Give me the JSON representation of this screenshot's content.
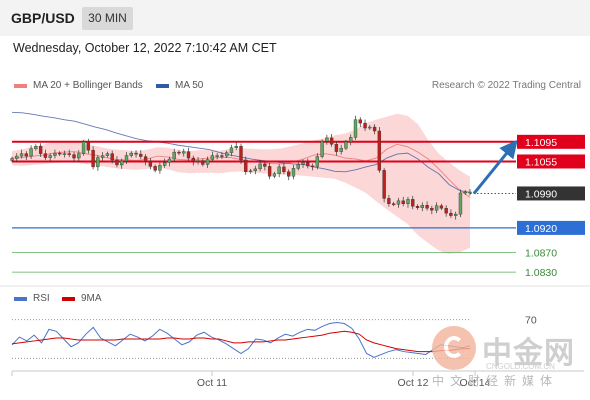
{
  "header": {
    "symbol": "GBP/USD",
    "timeframe": "30 MIN"
  },
  "datetime": "Wednesday, October 12, 2022 7:10:42 AM CET",
  "legend": {
    "bb_label": "MA 20 + Bollinger Bands",
    "bb_color": "#f08080",
    "ma50_label": "MA 50",
    "ma50_color": "#2e5da8"
  },
  "copyright": "Research © 2022 Trading Central",
  "rsi_legend": {
    "rsi_label": "RSI",
    "rsi_color": "#4a74c9",
    "ma_label": "9MA",
    "ma_color": "#d00000"
  },
  "watermark": {
    "brand": "中金网",
    "url": "CNGOLD.COM.CN",
    "subtitle": "中文财经新媒体"
  },
  "colors": {
    "resistance": "#e0001b",
    "support": "#2e6fd6",
    "target": "#5aab5a",
    "current": "#333333",
    "bull": "#5fa85f",
    "bear": "#c0201b",
    "arrow": "#2e6fb4"
  },
  "chart_data": [
    {
      "type": "candlestick",
      "y_axis_side": "right",
      "ylim": [
        1.081,
        1.118
      ],
      "x_ticks": [
        "Oct 11",
        "Oct 12",
        "Oct 14"
      ],
      "levels": [
        {
          "value": 1.1095,
          "label": "1.1095",
          "kind": "resistance"
        },
        {
          "value": 1.1055,
          "label": "1.1055",
          "kind": "resistance"
        },
        {
          "value": 1.099,
          "label": "1.0990",
          "kind": "current"
        },
        {
          "value": 1.092,
          "label": "1.0920",
          "kind": "support"
        },
        {
          "value": 1.087,
          "label": "1.0870",
          "kind": "target"
        },
        {
          "value": 1.083,
          "label": "1.0830",
          "kind": "target"
        }
      ],
      "closes": [
        1.1061,
        1.1066,
        1.1071,
        1.1066,
        1.1081,
        1.1086,
        1.1071,
        1.1063,
        1.1067,
        1.1072,
        1.107,
        1.1071,
        1.1069,
        1.1062,
        1.1071,
        1.1095,
        1.1078,
        1.1044,
        1.1063,
        1.1067,
        1.1071,
        1.1058,
        1.1048,
        1.1056,
        1.1067,
        1.1072,
        1.107,
        1.1065,
        1.1055,
        1.1045,
        1.1037,
        1.1047,
        1.1053,
        1.106,
        1.1074,
        1.1072,
        1.1075,
        1.1062,
        1.1055,
        1.1057,
        1.1049,
        1.1059,
        1.1067,
        1.1067,
        1.1066,
        1.1073,
        1.1083,
        1.1086,
        1.1058,
        1.1034,
        1.1036,
        1.104,
        1.105,
        1.1045,
        1.1025,
        1.103,
        1.1044,
        1.1034,
        1.1025,
        1.1041,
        1.1049,
        1.1053,
        1.1046,
        1.1045,
        1.1065,
        1.1096,
        1.1103,
        1.109,
        1.1075,
        1.1082,
        1.1095,
        1.1104,
        1.114,
        1.1133,
        1.1123,
        1.1125,
        1.1117,
        1.1037,
        1.098,
        1.0969,
        1.0968,
        1.0975,
        1.0969,
        1.0978,
        1.0964,
        1.0961,
        1.0966,
        1.096,
        1.0956,
        1.0965,
        1.096,
        1.095,
        1.0945,
        1.0948,
        1.0991,
        1.0993,
        1.0993
      ],
      "ma50": [
        1.1155,
        1.1154,
        1.1151,
        1.1147,
        1.1144,
        1.114,
        1.1137,
        1.1131,
        1.1125,
        1.112,
        1.1113,
        1.1107,
        1.1101,
        1.1097,
        1.1095,
        1.1092,
        1.1088,
        1.1085,
        1.1082,
        1.1079,
        1.1073,
        1.1068,
        1.1064,
        1.106,
        1.1057,
        1.1055,
        1.1052,
        1.105,
        1.1049,
        1.1044,
        1.104,
        1.1035,
        1.1034,
        1.1038,
        1.1044,
        1.1049,
        1.1062,
        1.107,
        1.1072,
        1.106,
        1.1043,
        1.103,
        1.1008,
        1.0996,
        1.0992
      ],
      "bb_mid": [
        1.1062,
        1.1063,
        1.1066,
        1.1068,
        1.1072,
        1.1074,
        1.1075,
        1.1071,
        1.1068,
        1.1063,
        1.1059,
        1.1058,
        1.1057,
        1.106,
        1.1066,
        1.1064,
        1.1059,
        1.1058,
        1.106,
        1.1062,
        1.1063,
        1.1063,
        1.1059,
        1.1055,
        1.1053,
        1.1051,
        1.105,
        1.1054,
        1.106,
        1.1068,
        1.1071,
        1.1068,
        1.1062,
        1.106,
        1.1056,
        1.1062,
        1.108,
        1.109,
        1.1085,
        1.1074,
        1.106,
        1.104,
        1.1018,
        1.0997,
        1.0982
      ],
      "bb_upper": [
        1.1076,
        1.108,
        1.1085,
        1.1089,
        1.1095,
        1.1096,
        1.1096,
        1.109,
        1.1087,
        1.1082,
        1.1079,
        1.1078,
        1.1076,
        1.1079,
        1.1084,
        1.1083,
        1.1078,
        1.1076,
        1.1078,
        1.1078,
        1.1077,
        1.1081,
        1.1082,
        1.1081,
        1.108,
        1.108,
        1.1082,
        1.1087,
        1.1092,
        1.1098,
        1.1102,
        1.1108,
        1.1112,
        1.112,
        1.1133,
        1.114,
        1.1146,
        1.1152,
        1.1148,
        1.1131,
        1.1098,
        1.1071,
        1.1053,
        1.1037,
        1.1024
      ],
      "bb_lower": [
        1.1047,
        1.1046,
        1.1048,
        1.105,
        1.1052,
        1.1053,
        1.1054,
        1.105,
        1.1048,
        1.1044,
        1.1041,
        1.1039,
        1.1038,
        1.104,
        1.1043,
        1.1039,
        1.1033,
        1.1031,
        1.1032,
        1.1032,
        1.1031,
        1.1034,
        1.1035,
        1.1032,
        1.1031,
        1.103,
        1.1028,
        1.1028,
        1.1026,
        1.1024,
        1.1022,
        1.102,
        1.1012,
        1.1002,
        1.0991,
        1.0974,
        1.0958,
        1.0943,
        1.0928,
        1.0905,
        1.0889,
        1.0874,
        1.0867,
        1.087,
        1.088
      ]
    },
    {
      "type": "line",
      "ylim": [
        20,
        80
      ],
      "y_ticks": [
        70
      ],
      "series": [
        {
          "name": "RSI",
          "values": [
            44,
            52,
            48,
            54,
            46,
            60,
            58,
            50,
            42,
            46,
            55,
            62,
            51,
            47,
            43,
            49,
            55,
            52,
            48,
            53,
            60,
            56,
            50,
            44,
            47,
            54,
            57,
            52,
            49,
            45,
            40,
            35,
            40,
            50,
            49,
            46,
            51,
            55,
            53,
            57,
            60,
            59,
            63,
            66,
            67,
            66,
            61,
            50,
            35,
            31,
            34,
            37,
            39,
            37,
            36,
            35,
            34,
            39,
            44,
            43,
            42,
            41,
            43
          ]
        },
        {
          "name": "9MA",
          "values": [
            45,
            46,
            47,
            48,
            49,
            50,
            51,
            51,
            50,
            49,
            49,
            49,
            49,
            49,
            49,
            50,
            50,
            50,
            50,
            50,
            50,
            51,
            51,
            50,
            50,
            51,
            51,
            50,
            50,
            48,
            46,
            46,
            47,
            47,
            47,
            48,
            49,
            49,
            50,
            51,
            52,
            53,
            54,
            56,
            57,
            58,
            57,
            55,
            49,
            46,
            44,
            42,
            40,
            39,
            38,
            37,
            37,
            37,
            38,
            38,
            39,
            40,
            40
          ]
        }
      ]
    }
  ]
}
